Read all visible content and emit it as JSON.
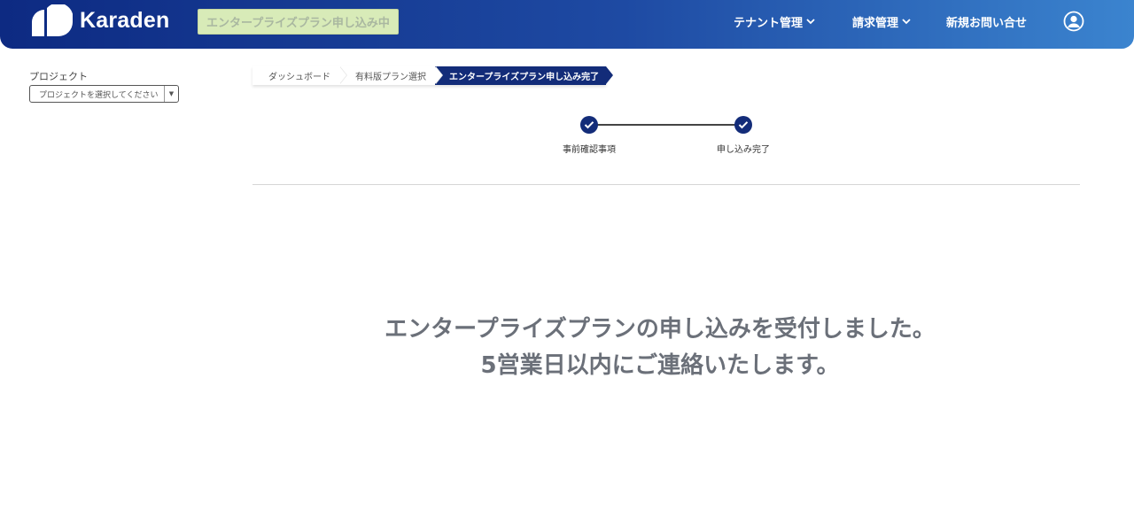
{
  "header": {
    "logo_text": "Karaden",
    "status_pill": "エンタープライズプラン申し込み中",
    "nav": {
      "tenant": "テナント管理",
      "billing": "請求管理",
      "contact": "新規お問い合せ"
    },
    "icons": {
      "chevron": "chevron-down-icon",
      "user": "user-circle-icon"
    }
  },
  "sidebar": {
    "project_label": "プロジェクト",
    "project_select_value": "プロジェクトを選択してください"
  },
  "breadcrumb": {
    "items": [
      "ダッシュボード",
      "有料版プラン選択",
      "エンタープライズプラン申し込み完了"
    ]
  },
  "stepper": {
    "steps": [
      "事前確認事項",
      "申し込み完了"
    ],
    "completed": 2
  },
  "message": {
    "line1": "エンタープライズプランの申し込みを受付しました。",
    "line2": "5営業日以内にご連絡いたします。"
  },
  "colors": {
    "header_start": "#0d2a82",
    "header_end": "#3b84cf",
    "accent": "#132c79",
    "status_pill_bg": "#d8ebb8",
    "message_text": "#6b7079"
  }
}
